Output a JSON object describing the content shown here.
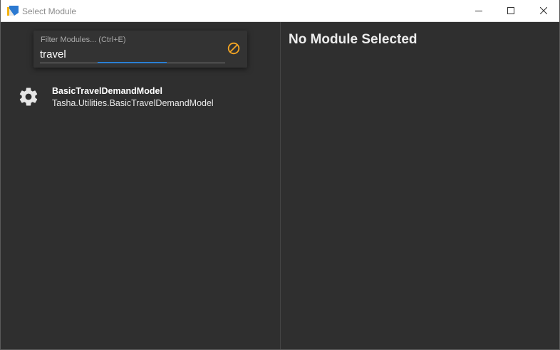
{
  "window": {
    "title": "Select Module",
    "app_icon": "xtmf-app-icon",
    "controls": {
      "minimize_icon": "minimize-icon",
      "maximize_icon": "maximize-icon",
      "close_icon": "close-icon"
    }
  },
  "filter": {
    "hint": "Filter Modules... (Ctrl+E)",
    "value": "travel",
    "clear_icon": "clear-filter-icon",
    "accent_color": "#f5a623",
    "focus_color": "#2a7fd4"
  },
  "modules": [
    {
      "icon": "gear-icon",
      "name": "BasicTravelDemandModel",
      "full_name": "Tasha.Utilities.BasicTravelDemandModel"
    }
  ],
  "detail": {
    "title": "No Module Selected"
  }
}
